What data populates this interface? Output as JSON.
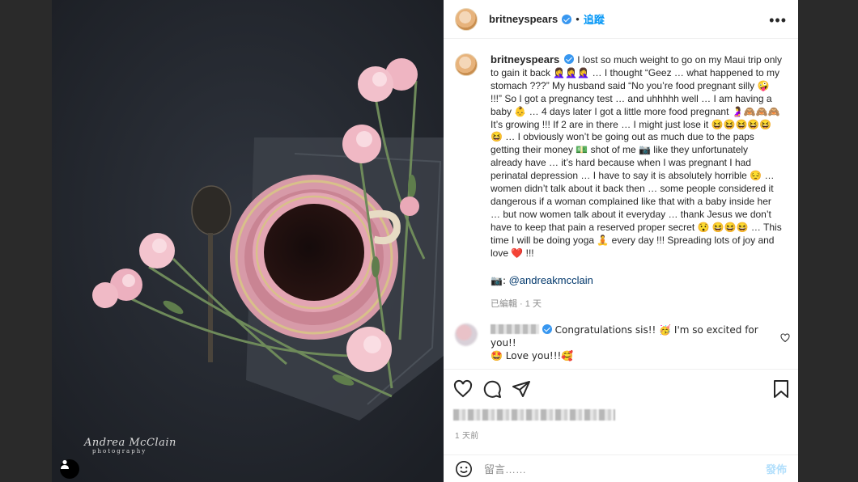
{
  "header": {
    "username": "britneyspears",
    "follow_label": "追蹤",
    "more_icon": "more-horizontal-icon"
  },
  "photo": {
    "watermark_name": "Andrea McClain",
    "watermark_sub": "photography"
  },
  "caption": {
    "username": "britneyspears",
    "lines": [
      "I lost so much weight to go on my Maui trip only",
      "to gain it back 🤦‍♀️🤦‍♀️🤦‍♀️ … I thought “Geez … what happened to my",
      "stomach ???” My husband said “No you’re food pregnant silly 🤪",
      "!!!” So I got a pregnancy test … and uhhhhh well … I am having a",
      "baby 👶 … 4 days later I got a little more food pregnant 🤰🙈🙈🙈",
      "It’s growing !!! If 2 are in there … I might just lose it 😆😆😆😆😆",
      "😆 … I obviously won’t be going out as much due to the paps",
      "getting their money 💵 shot of me 📷 like they unfortunately",
      "already have … it’s hard because when I was pregnant I had",
      "perinatal depression … I have to say it is absolutely horrible 😔 …",
      "women didn’t talk about it back then … some people considered it",
      "dangerous if a woman complained like that with a baby inside her",
      "… but now women talk about it everyday … thank Jesus we don’t",
      "have to keep that pain a reserved proper secret 😯 😆😆😆 … This",
      "time I will be doing yoga 🧘 every day !!! Spreading lots of joy and",
      "love ❤️ !!!"
    ],
    "credit_prefix": "📷:",
    "credit_link": "@andreakmcclain",
    "edited_meta": "已編輯 · 1 天"
  },
  "comment": {
    "text_line1": "Congratulations sis!! 🥳 I'm so excited for you!!",
    "text_line2": "🤩 Love you!!!🥰"
  },
  "footer": {
    "time": "1 天前",
    "comment_placeholder": "留言……",
    "post_label": "發佈"
  },
  "colors": {
    "accent": "#0095f6",
    "verified": "#3897f0",
    "link": "#00376b",
    "muted": "#8e8e8e"
  }
}
